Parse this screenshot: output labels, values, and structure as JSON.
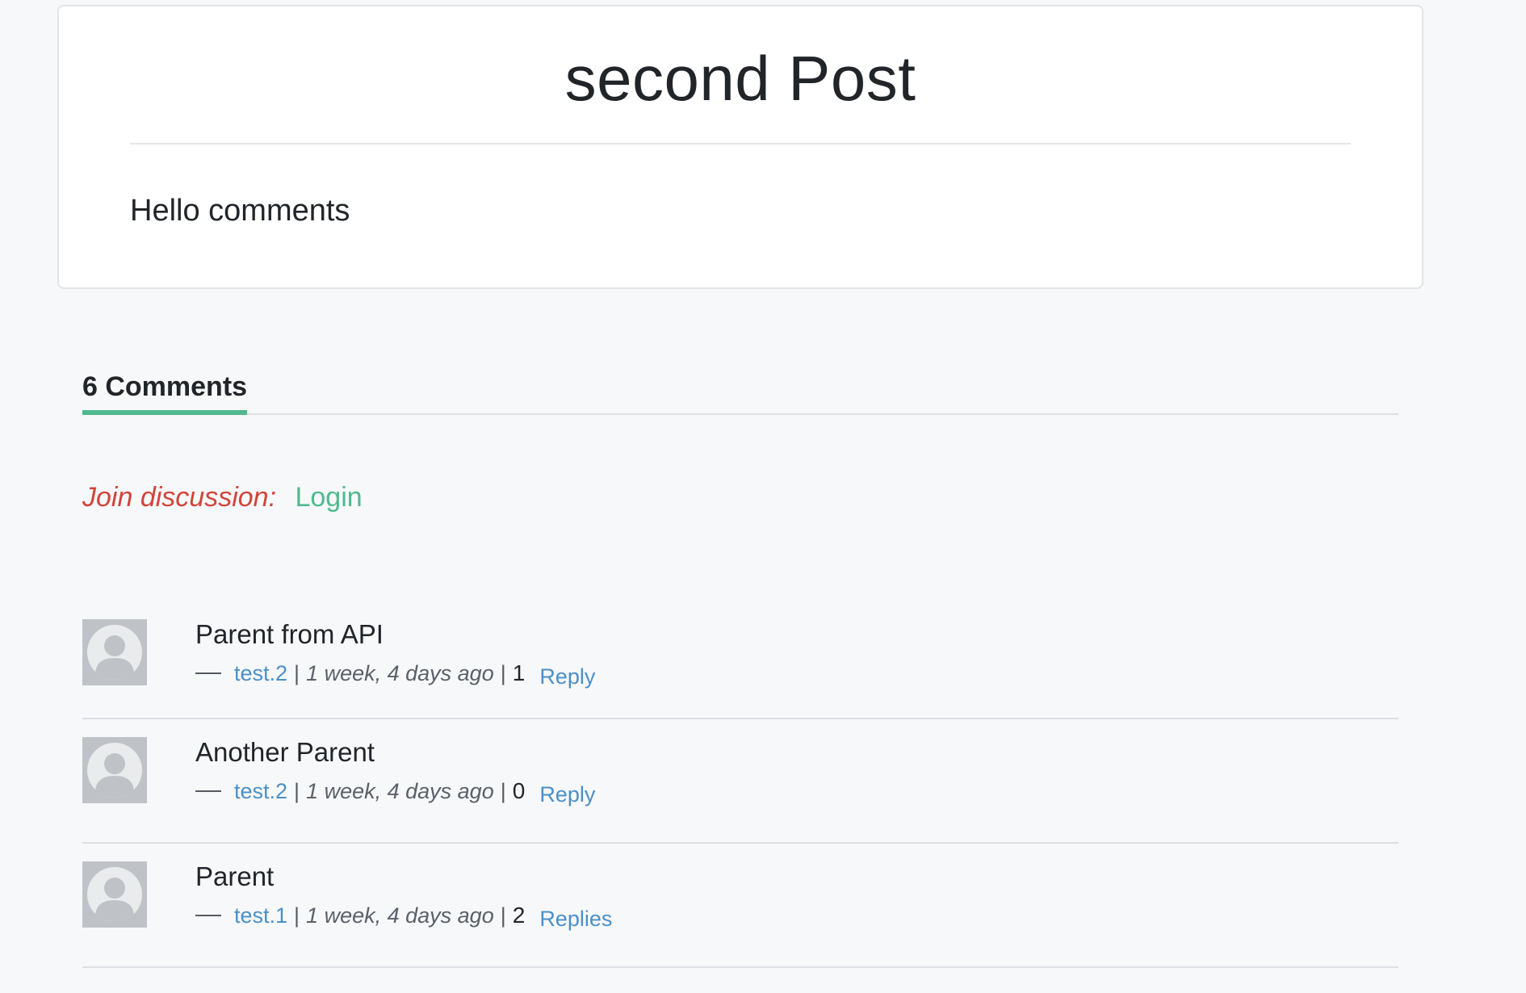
{
  "post": {
    "title": "second Post",
    "body": "Hello comments"
  },
  "comments_section": {
    "count_label": "6 Comments",
    "accent_color": "#4fb98d",
    "join_label": "Join discussion:",
    "login_label": "Login"
  },
  "comments": [
    {
      "text": "Parent from API",
      "author": "test.2",
      "time": "1 week, 4 days ago",
      "reply_count": "1",
      "reply_label": "Reply",
      "avatar_icon": "user-avatar-icon"
    },
    {
      "text": "Another Parent",
      "author": "test.2",
      "time": "1 week, 4 days ago",
      "reply_count": "0",
      "reply_label": "Reply",
      "avatar_icon": "user-avatar-icon"
    },
    {
      "text": "Parent",
      "author": "test.1",
      "time": "1 week, 4 days ago",
      "reply_count": "2",
      "reply_label": "Replies",
      "avatar_icon": "user-avatar-icon"
    }
  ],
  "separators": {
    "pipe": "|"
  }
}
